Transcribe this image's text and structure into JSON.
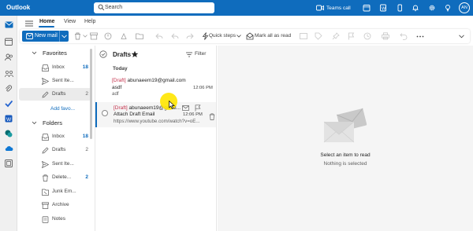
{
  "app": {
    "name": "Outlook",
    "brand_color": "#0f6cbd"
  },
  "search": {
    "placeholder": "Search"
  },
  "titlebar": {
    "teams_call": "Teams call",
    "avatar_initials": "AN"
  },
  "tabs": [
    {
      "label": "Home",
      "active": true
    },
    {
      "label": "View"
    },
    {
      "label": "Help"
    }
  ],
  "ribbon": {
    "new_mail": "New mail",
    "quick_steps": "Quick steps",
    "mark_all_read": "Mark all as read"
  },
  "favorites": {
    "title": "Favorites",
    "items": [
      {
        "label": "Inbox",
        "count": "18"
      },
      {
        "label": "Sent Ite...",
        "count": ""
      },
      {
        "label": "Drafts",
        "count": "2"
      }
    ],
    "add_favorite": "Add favo..."
  },
  "folders": {
    "title": "Folders",
    "items": [
      {
        "label": "Inbox",
        "count": "18"
      },
      {
        "label": "Drafts",
        "count": "2"
      },
      {
        "label": "Sent Ite...",
        "count": ""
      },
      {
        "label": "Delete...",
        "count": "2"
      },
      {
        "label": "Junk Em...",
        "count": ""
      },
      {
        "label": "Archive",
        "count": ""
      },
      {
        "label": "Notes",
        "count": ""
      }
    ]
  },
  "message_list": {
    "title": "Drafts",
    "filter": "Filter",
    "group": "Today",
    "messages": [
      {
        "tag": "[Draft]",
        "from": "abunaeem19@gmail.com",
        "subject": "asdf",
        "preview": "adf",
        "time": "12:06 PM"
      },
      {
        "tag": "[Draft]",
        "from": "abunaeem19@gmail...",
        "subject": "Attach Draft Email",
        "preview": "https://www.youtube.com/watch?v=oE...",
        "time": "12:06 PM"
      }
    ]
  },
  "reading_pane": {
    "empty_title": "Select an item to read",
    "empty_subtitle": "Nothing is selected"
  }
}
